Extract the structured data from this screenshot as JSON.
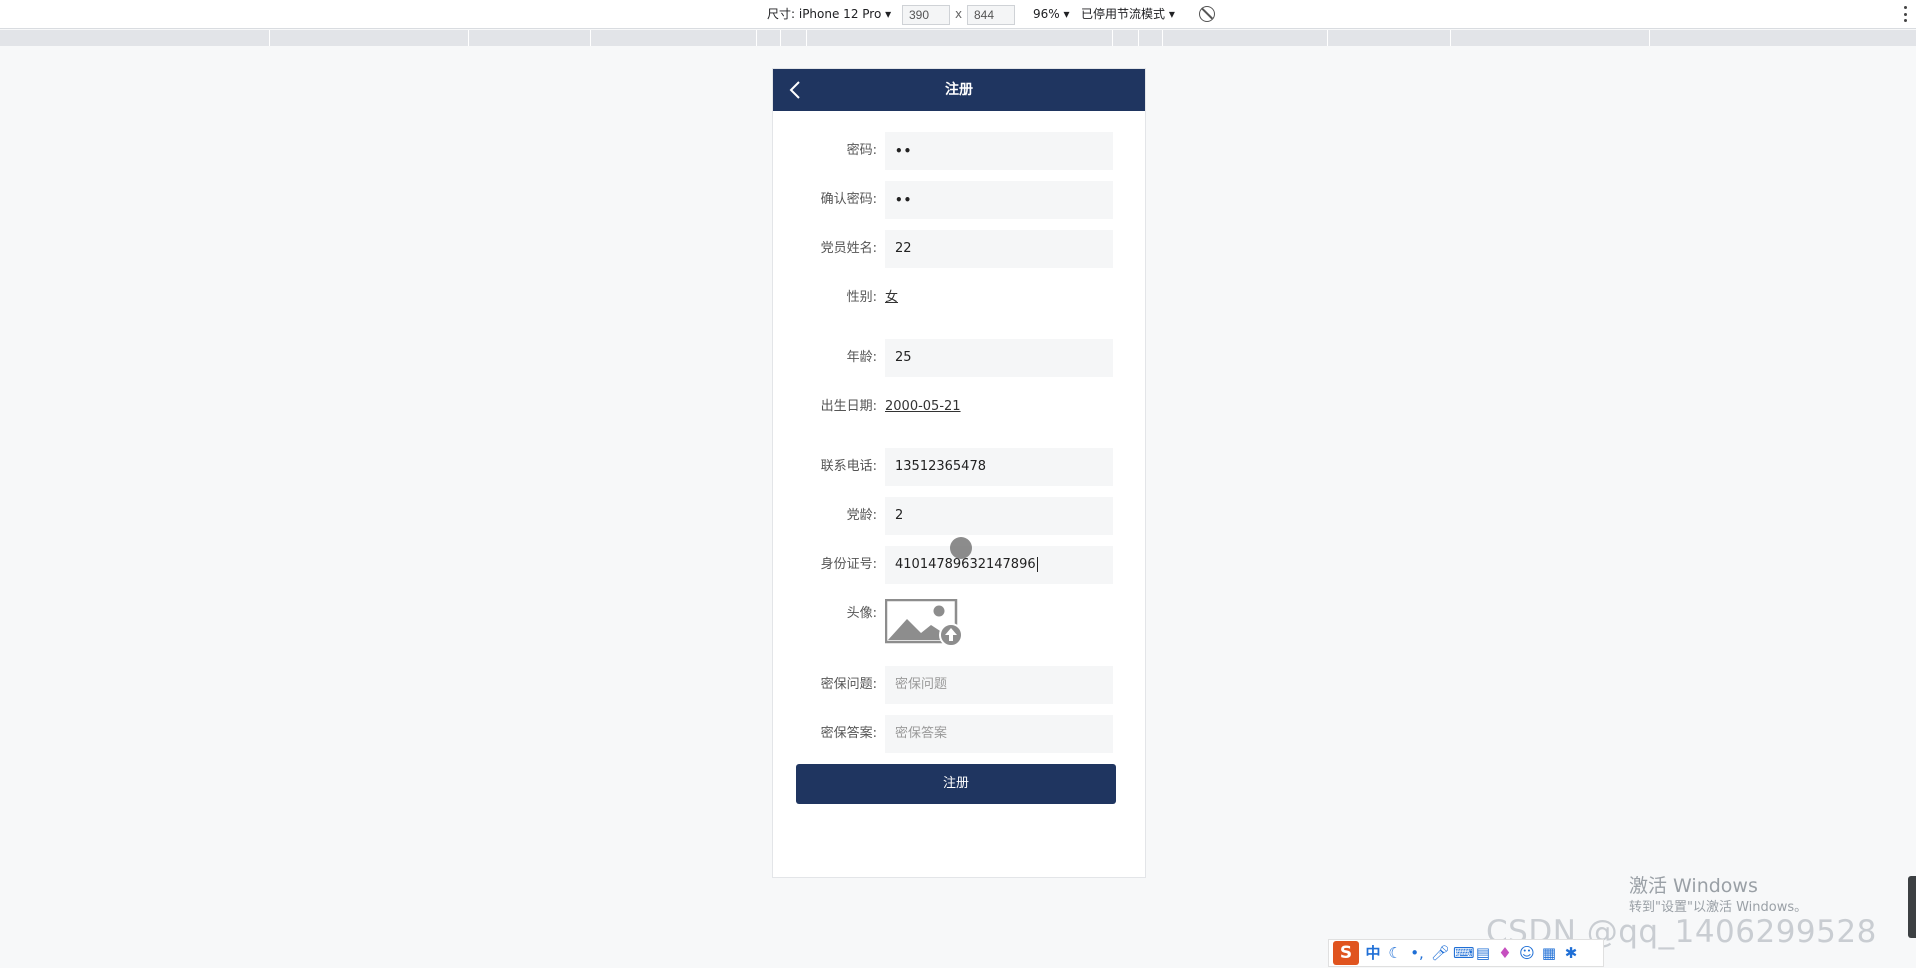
{
  "devtools": {
    "device_label": "尺寸: iPhone 12 Pro ▾",
    "width_value": "390",
    "times": "x",
    "height_value": "844",
    "zoom_label": "96% ▾",
    "throttle_label": "已停用节流模式 ▾",
    "rotate_icon": "no-throttle-icon",
    "menu_icon": "kebab-menu-icon"
  },
  "app": {
    "nav_title": "注册",
    "back_icon": "chevron-left-icon",
    "colors": {
      "primary": "#1f3560",
      "field_bg": "#f5f6f7"
    }
  },
  "form": {
    "password": {
      "label": "密码:",
      "value": "••"
    },
    "confirm_password": {
      "label": "确认密码:",
      "value": "••"
    },
    "member_name": {
      "label": "党员姓名:",
      "value": "22"
    },
    "gender": {
      "label": "性别:",
      "value": "女"
    },
    "age": {
      "label": "年龄:",
      "value": "25"
    },
    "birthdate": {
      "label": "出生日期:",
      "value": "2000-05-21"
    },
    "phone": {
      "label": "联系电话:",
      "value": "13512365478"
    },
    "party_age": {
      "label": "党龄:",
      "value": "2"
    },
    "id_number": {
      "label": "身份证号:",
      "value": "41014789632147896"
    },
    "avatar": {
      "label": "头像:",
      "icon": "image-upload-icon"
    },
    "security_question": {
      "label": "密保问题:",
      "placeholder": "密保问题"
    },
    "security_answer": {
      "label": "密保答案:",
      "placeholder": "密保答案"
    },
    "submit_label": "注册"
  },
  "watermark": {
    "win_title": "激活 Windows",
    "win_sub": "转到\"设置\"以激活 Windows。",
    "csdn": "CSDN @qq_1406299528"
  },
  "ime": {
    "logo": "S",
    "lang": "中",
    "icons": [
      "moon-icon",
      "punctuation-icon",
      "microphone-icon",
      "keyboard-icon",
      "toolbox-icon",
      "skin-icon",
      "game-icon",
      "apps-icon",
      "settings-icon"
    ]
  }
}
